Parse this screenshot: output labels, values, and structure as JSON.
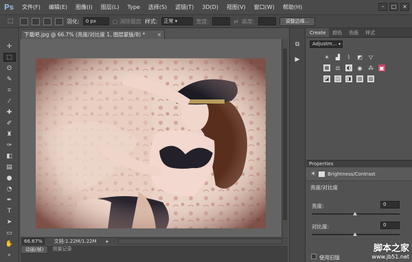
{
  "menubar": {
    "logo": "Ps",
    "items": [
      "文件(F)",
      "编辑(E)",
      "图像(I)",
      "图层(L)",
      "Type",
      "选择(S)",
      "滤镜(T)",
      "3D(D)",
      "视图(V)",
      "窗口(W)",
      "帮助(H)"
    ],
    "win_buttons": [
      "–",
      "□",
      "×"
    ]
  },
  "options": {
    "feather_label": "羽化:",
    "feather_value": "0 px",
    "antialias_label": "消除锯齿",
    "style_label": "样式:",
    "style_value": "正常",
    "width_label": "宽度:",
    "height_label": "高度:",
    "refine_button": "调整边缘..."
  },
  "document": {
    "tab_title": "下载吧.jpg @ 66.7% (亮度/对比度 1, 图层蒙版/8) *",
    "close": "×"
  },
  "status": {
    "zoom": "66.67%",
    "doc_info": "文档:1.22M/1.22M"
  },
  "bottom_tabs": [
    "动画(帧)",
    "测量记录"
  ],
  "panel": {
    "tabs": [
      "Create",
      "颜色",
      "色板",
      "样式"
    ],
    "adjustments_dropdown": "Adjustm...",
    "properties_tab": "Properties",
    "adjustment_name": "Brightness/Contrast",
    "title_cn": "亮度/对比度",
    "brightness_label": "亮度:",
    "brightness_value": "0",
    "contrast_label": "对比度:",
    "contrast_value": "0",
    "legacy_label": "使用旧版"
  },
  "watermark": {
    "line1": "脚本之家",
    "line2": "www.jb51.net"
  },
  "colors": {
    "ui_bg": "#535353",
    "panel_bg": "#525252",
    "canvas_bg": "#646464"
  }
}
